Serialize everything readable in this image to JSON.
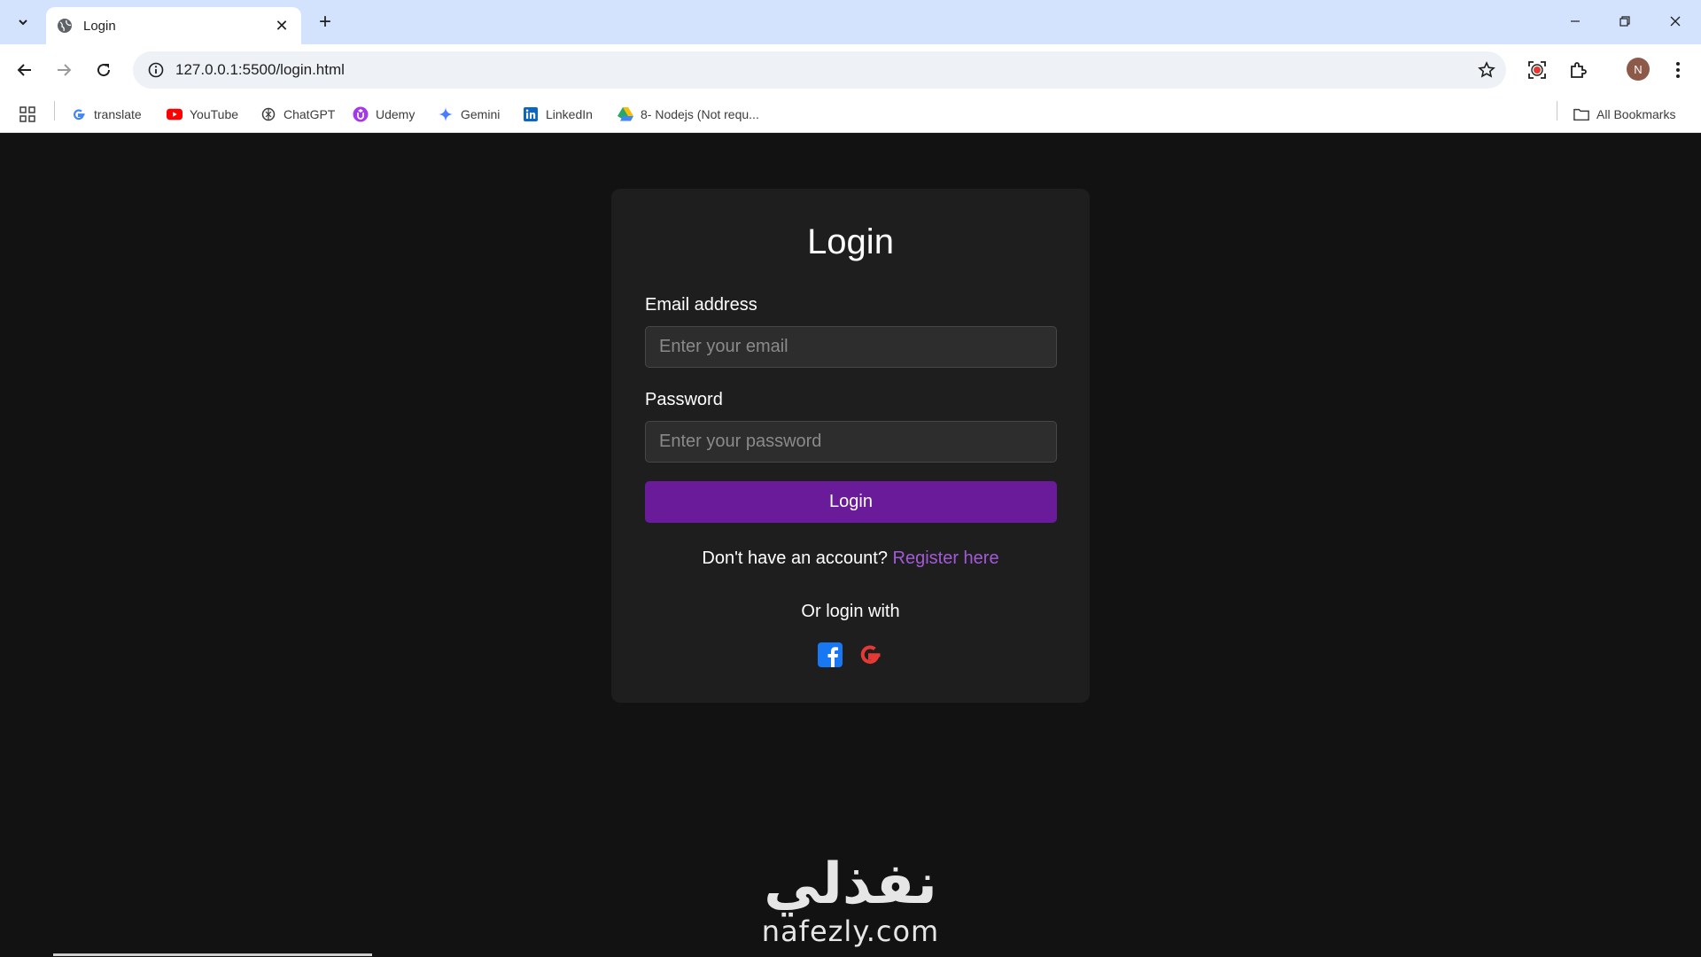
{
  "browser": {
    "tab": {
      "title": "Login"
    },
    "address_bar": {
      "url": "127.0.0.1:5500/login.html"
    },
    "profile_initial": "N",
    "bookmarks": [
      {
        "label": "translate",
        "icon": "google-icon"
      },
      {
        "label": "YouTube",
        "icon": "youtube-icon"
      },
      {
        "label": "ChatGPT",
        "icon": "chatgpt-icon"
      },
      {
        "label": "Udemy",
        "icon": "udemy-icon"
      },
      {
        "label": "Gemini",
        "icon": "gemini-icon"
      },
      {
        "label": "LinkedIn",
        "icon": "linkedin-icon"
      },
      {
        "label": "8- Nodejs (Not requ...",
        "icon": "google-drive-icon"
      }
    ],
    "all_bookmarks_label": "All Bookmarks"
  },
  "login": {
    "title": "Login",
    "email": {
      "label": "Email address",
      "placeholder": "Enter your email",
      "value": ""
    },
    "password": {
      "label": "Password",
      "placeholder": "Enter your password",
      "value": ""
    },
    "submit_label": "Login",
    "register_prompt": "Don't have an account?",
    "register_link": "Register here",
    "social_prompt": "Or login with",
    "social": [
      {
        "icon": "facebook-icon"
      },
      {
        "icon": "google-icon"
      }
    ]
  },
  "watermark": {
    "arabic": "نفذلي",
    "latin": "nafezly.com"
  },
  "colors": {
    "page_bg": "#121212",
    "card_bg": "#1e1e1e",
    "accent": "#6a1b9a",
    "link": "#a35ad8",
    "facebook": "#1877f2",
    "google": "#e53935"
  }
}
